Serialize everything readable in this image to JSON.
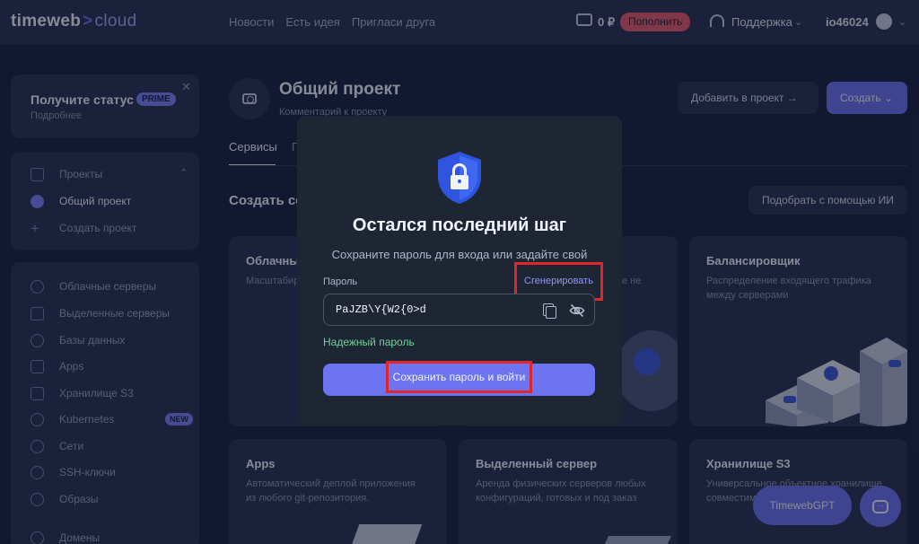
{
  "header": {
    "logo_main": "timeweb",
    "logo_arrow": ">",
    "logo_cloud": "cloud",
    "nav": [
      "Новости",
      "Есть идея",
      "Пригласи друга"
    ],
    "balance": "0 ₽",
    "topup_label": "Пополнить",
    "support_label": "Поддержка",
    "user": "io46024"
  },
  "sidebar": {
    "prime_title": "Получите статус",
    "prime_badge": "PRIME",
    "prime_sub": "Подробнее",
    "projects_label": "Проекты",
    "project_active": "Общий проект",
    "create_project": "Создать проект",
    "services": [
      {
        "label": "Облачные серверы",
        "icon": "cloud-icon"
      },
      {
        "label": "Выделенные серверы",
        "icon": "server-icon"
      },
      {
        "label": "Базы данных",
        "icon": "database-icon"
      },
      {
        "label": "Apps",
        "icon": "apps-icon"
      },
      {
        "label": "Хранилище S3",
        "icon": "storage-icon"
      },
      {
        "label": "Kubernetes",
        "icon": "kubernetes-icon",
        "badge": "NEW"
      },
      {
        "label": "Сети",
        "icon": "network-icon"
      },
      {
        "label": "SSH-ключи",
        "icon": "key-icon"
      },
      {
        "label": "Образы",
        "icon": "image-icon"
      },
      {
        "label": "Домены",
        "icon": "globe-icon"
      }
    ]
  },
  "main": {
    "project_title": "Общий проект",
    "project_comment": "Комментарий к проекту",
    "add_to_project": "Добавить в проект →",
    "create_label": "Создать ⌄",
    "tab_services": "Сервисы",
    "tab_next": "П",
    "create_heading": "Создать се",
    "ai_button": "Подобрать с помощью ИИ",
    "tiles": [
      {
        "title": "Облачны",
        "desc": "Масштабир с размещен"
      },
      {
        "title": "",
        "desc": "е не"
      },
      {
        "title": "Балансировщик",
        "desc": "Распределение входящего трафика между серверами"
      },
      {
        "title": "Apps",
        "desc": "Автоматический деплой приложения из любого git-репозитория."
      },
      {
        "title": "Выделенный сервер",
        "desc": "Аренда физических серверов любых конфигураций, готовых и под заказ"
      },
      {
        "title": "Хранилище S3",
        "desc": "Универсальное объектное хранилище совместимое"
      }
    ],
    "gpt_button": "TimewebGPT"
  },
  "modal": {
    "title": "Остался последний шаг",
    "subtitle": "Сохраните пароль для входа или задайте свой",
    "password_label": "Пароль",
    "generate_label": "Сгенерировать",
    "password_value": "PaJZB\\Y{W2{0>d",
    "strength": "Надежный пароль",
    "submit_label": "Сохранить пароль и войти"
  },
  "colors": {
    "accent": "#6c74f0",
    "background": "#1b2440",
    "card": "#2a3352",
    "modal": "#1f2633",
    "success": "#6ed49a",
    "highlight": "#e0262d"
  }
}
